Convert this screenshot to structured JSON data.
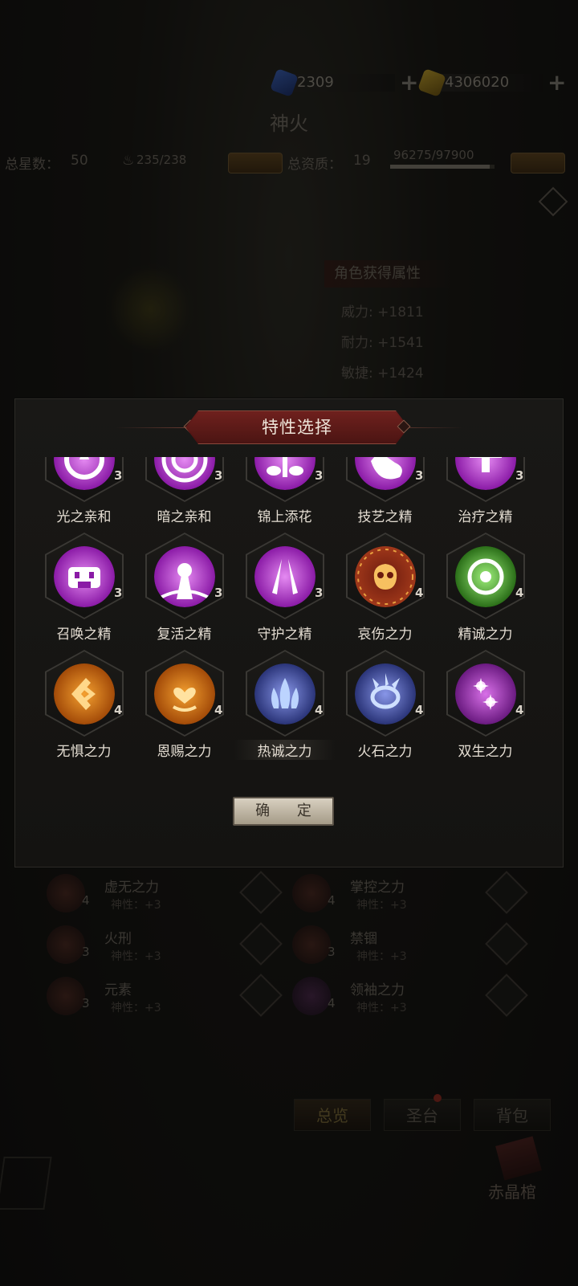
{
  "header": {
    "currency1": "2309",
    "currency2": "4306020",
    "title": "神火"
  },
  "stats": {
    "stars_label": "总星数：",
    "stars_value": "50",
    "fire_count": "235/238",
    "quality_label": "总资质：",
    "quality_value": "19",
    "exp": "96275/97900"
  },
  "attributes": {
    "heading": "角色获得属性",
    "items": [
      "威力: +1811",
      "耐力: +1541",
      "敏捷: +1424"
    ]
  },
  "modal": {
    "title": "特性选择",
    "confirm": "确 定",
    "rows": [
      [
        {
          "name": "光之亲和",
          "level": "3",
          "icon": "light-affinity-icon",
          "color": "#b026c9"
        },
        {
          "name": "暗之亲和",
          "level": "3",
          "icon": "dark-affinity-icon",
          "color": "#b026c9"
        },
        {
          "name": "锦上添花",
          "level": "3",
          "icon": "embellish-icon",
          "color": "#b026c9"
        },
        {
          "name": "技艺之精",
          "level": "3",
          "icon": "skill-essence-icon",
          "color": "#b026c9"
        },
        {
          "name": "治疗之精",
          "level": "3",
          "icon": "heal-essence-icon",
          "color": "#b026c9"
        }
      ],
      [
        {
          "name": "召唤之精",
          "level": "3",
          "icon": "summon-essence-icon",
          "color": "#b026c9"
        },
        {
          "name": "复活之精",
          "level": "3",
          "icon": "revive-essence-icon",
          "color": "#b026c9"
        },
        {
          "name": "守护之精",
          "level": "3",
          "icon": "guard-essence-icon",
          "color": "#b026c9"
        },
        {
          "name": "哀伤之力",
          "level": "4",
          "icon": "sorrow-power-icon",
          "color": "#b8401a"
        },
        {
          "name": "精诚之力",
          "level": "4",
          "icon": "sincerity-power-icon",
          "color": "#3f9e2a"
        }
      ],
      [
        {
          "name": "无惧之力",
          "level": "4",
          "icon": "fearless-power-icon",
          "color": "#d86a10"
        },
        {
          "name": "恩赐之力",
          "level": "4",
          "icon": "grace-power-icon",
          "color": "#d86a10"
        },
        {
          "name": "热诚之力",
          "level": "4",
          "icon": "zeal-power-icon",
          "color": "#4a58b8"
        },
        {
          "name": "火石之力",
          "level": "4",
          "icon": "flintstone-power-icon",
          "color": "#4a58b8"
        },
        {
          "name": "双生之力",
          "level": "4",
          "icon": "twin-power-icon",
          "color": "#9a2ab0"
        }
      ]
    ]
  },
  "bg_list": [
    {
      "name": "虚无之力",
      "level": "4",
      "sub": "神性：+3"
    },
    {
      "name": "掌控之力",
      "level": "4",
      "sub": "神性：+3"
    },
    {
      "name": "火刑",
      "level": "3",
      "sub": "神性：+3"
    },
    {
      "name": "禁锢",
      "level": "3",
      "sub": "神性：+3"
    },
    {
      "name": "元素",
      "level": "3",
      "sub": "神性：+3"
    },
    {
      "name": "领袖之力",
      "level": "4",
      "sub": "神性：+3"
    }
  ],
  "bottom_tabs": [
    "总览",
    "圣台",
    "背包"
  ],
  "chest_label": "赤晶棺",
  "colors": {
    "modal_bg": "#191816",
    "title_plate": "#6b1e1c",
    "confirm_bg": "#d8d0c0"
  }
}
